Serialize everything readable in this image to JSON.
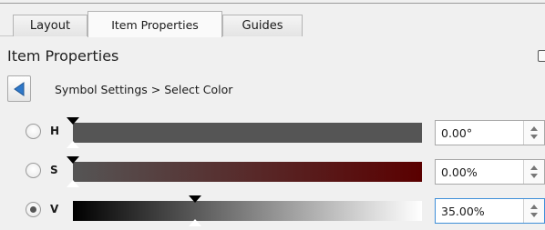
{
  "tabs": [
    {
      "label": "Layout",
      "active": false
    },
    {
      "label": "Item Properties",
      "active": true
    },
    {
      "label": "Guides",
      "active": false
    }
  ],
  "panel": {
    "title": "Item Properties",
    "back_icon": "back-arrow-icon",
    "breadcrumb": "Symbol Settings > Select Color"
  },
  "channels": [
    {
      "id": "h",
      "label": "H",
      "value": "0.00°",
      "selected": false,
      "slider_fraction": 0.0
    },
    {
      "id": "s",
      "label": "S",
      "value": "0.00%",
      "selected": false,
      "slider_fraction": 0.0
    },
    {
      "id": "v",
      "label": "V",
      "value": "35.00%",
      "selected": true,
      "slider_fraction": 0.35
    }
  ],
  "colors": {
    "hue_ramp": "#555555",
    "sat_ramp_start": "#555555",
    "sat_ramp_end": "#5a0000",
    "focus_border": "#3f8fd8"
  }
}
